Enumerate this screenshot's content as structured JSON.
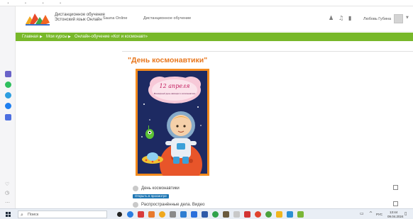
{
  "site": {
    "logo_line1": "Дистанционное обучение",
    "logo_line2": "Эстонский язык Онлайн"
  },
  "nav": {
    "items": [
      {
        "label": "Sauna Online"
      },
      {
        "label": "Дистанционное обучение"
      }
    ]
  },
  "header": {
    "user_name": "Любовь Губина"
  },
  "breadcrumb": {
    "items": [
      {
        "label": "Главная"
      },
      {
        "label": "Мои курсы"
      },
      {
        "label": "Онлайн-обучение «Кот и космонавт»"
      }
    ]
  },
  "content": {
    "title": "\"День космонавтики\"",
    "poster": {
      "line1": "12 апреля",
      "line2": "Всемирный день авиации и космонавтики"
    },
    "activities": [
      {
        "text": "День космонавтики"
      },
      {
        "badge": "Открыть в просмотре"
      },
      {
        "text": "Распространённые дела. Видео"
      }
    ]
  },
  "taskbar": {
    "search_placeholder": "Поиск",
    "lang": "РУС",
    "time": "13:44",
    "date": "09.04.2024"
  },
  "colors": {
    "breadcrumb_green": "#78b82a",
    "title_orange": "#e8761c",
    "badge_blue": "#1f77b4",
    "poster_navy": "#1d2a62"
  },
  "icons": {
    "left_rail": [
      "bookmark-icon",
      "whatsapp-icon",
      "telegram-icon",
      "messenger-icon",
      "app-icon",
      "heart-icon",
      "history-icon",
      "more-icon"
    ],
    "header": [
      "user-icon",
      "bell-icon",
      "chat-icon"
    ]
  }
}
